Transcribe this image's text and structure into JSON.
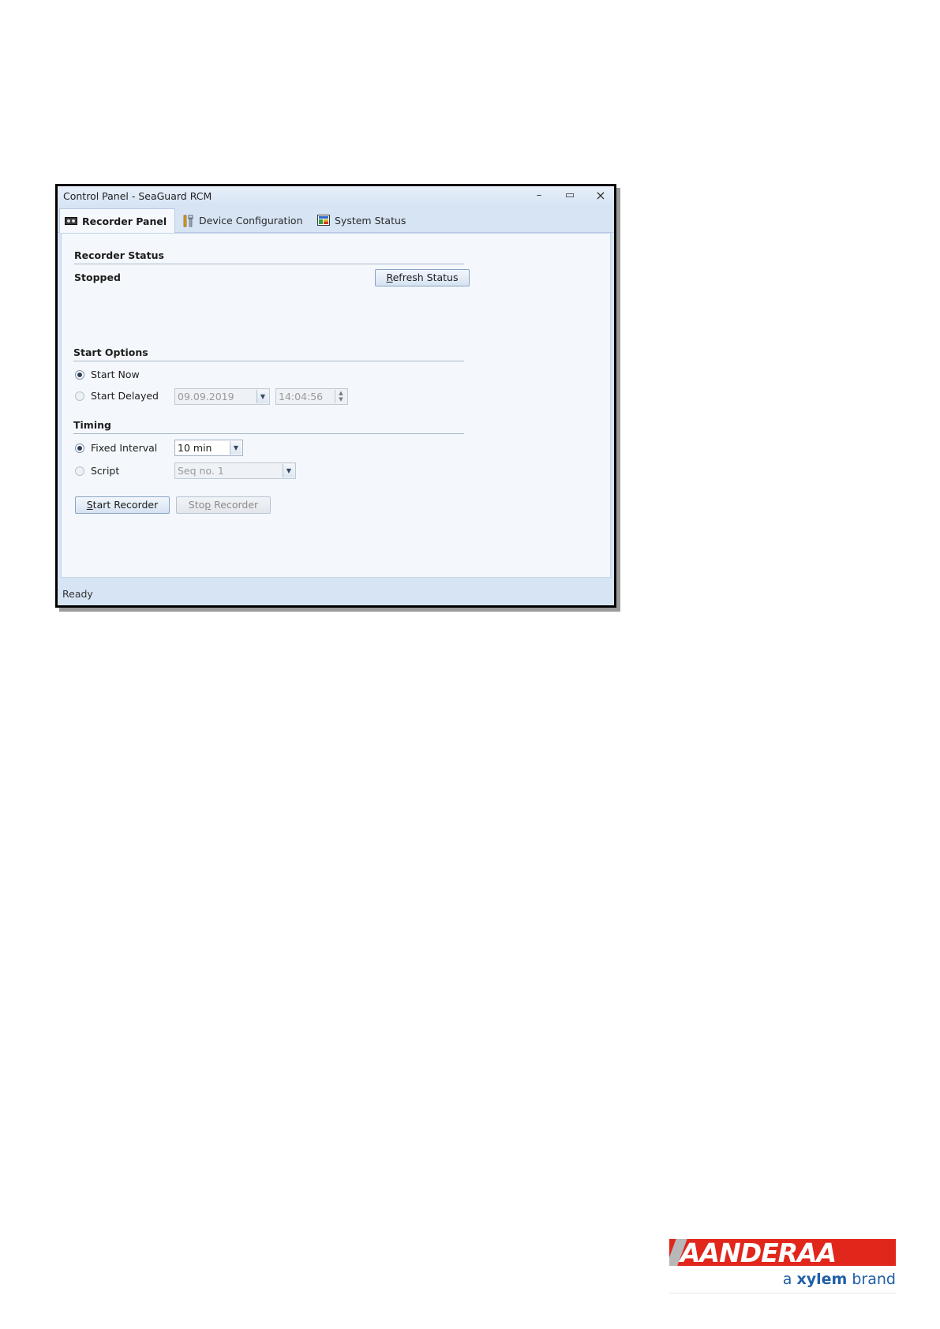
{
  "window": {
    "title": "Control Panel - SeaGuard RCM",
    "minimize_glyph": "–",
    "maximize_glyph": "▭",
    "close_glyph": "×"
  },
  "tabs": [
    {
      "label": "Recorder Panel",
      "icon": "recorder-icon",
      "active": true
    },
    {
      "label": "Device Configuration",
      "icon": "tools-icon",
      "active": false
    },
    {
      "label": "System Status",
      "icon": "status-icon",
      "active": false
    }
  ],
  "recorder_status": {
    "heading": "Recorder Status",
    "state": "Stopped",
    "refresh_prefix": "R",
    "refresh_rest": "efresh Status"
  },
  "start_options": {
    "heading": "Start Options",
    "start_now_label": "Start Now",
    "start_now_selected": true,
    "start_delayed_label": "Start Delayed",
    "start_delayed_selected": false,
    "date_value": "09.09.2019",
    "time_value": "14:04:56"
  },
  "timing": {
    "heading": "Timing",
    "fixed_interval_label": "Fixed Interval",
    "fixed_interval_selected": true,
    "interval_value": "10 min",
    "script_label": "Script",
    "script_selected": false,
    "script_value": "Seq no. 1"
  },
  "actions": {
    "start_prefix": "S",
    "start_rest": "tart Recorder",
    "stop_a": "Sto",
    "stop_ul": "p",
    "stop_b": " Recorder"
  },
  "status_bar": {
    "text": "Ready"
  },
  "logo": {
    "brand": "AANDERAA",
    "sub_a": "a ",
    "sub_xylem": "xylem",
    "sub_brand": " brand",
    "colors": {
      "red": "#e1261c",
      "blue": "#1f5fa8"
    }
  }
}
